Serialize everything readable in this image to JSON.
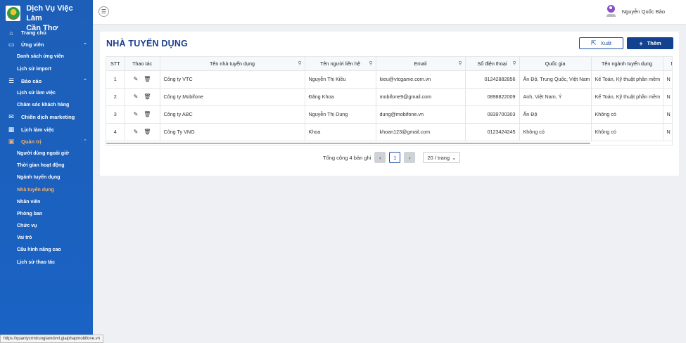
{
  "brand": {
    "title_line1": "Dịch Vụ Việc Làm",
    "title_line2": "Cần Thơ"
  },
  "sidebar": {
    "trang_chu": "Trang chủ",
    "ung_vien": "Ứng viên",
    "ung_vien_items": [
      "Danh sách ứng viên",
      "Lịch sử import"
    ],
    "bao_cao": "Báo cáo",
    "bao_cao_items": [
      "Lịch sử làm việc",
      "Chăm sóc khách hàng"
    ],
    "chien_dich": "Chiến dịch marketing",
    "lich_lam_viec": "Lịch làm việc",
    "quan_tri": "Quản trị",
    "quan_tri_items": [
      "Người dùng ngoài giờ",
      "Thời gian hoạt động",
      "Ngành tuyển dụng",
      "Nhà tuyển dụng",
      "Nhân viên",
      "Phòng ban",
      "Chức vụ",
      "Vai trò",
      "Cấu hình nâng cao",
      "Lịch sử thao tác"
    ]
  },
  "header": {
    "user_name": "Nguyễn Quốc Bảo"
  },
  "page": {
    "title": "NHÀ TUYỂN DỤNG",
    "export_label": "Xuất",
    "add_label": "Thêm"
  },
  "table": {
    "headers": [
      "STT",
      "Thao tác",
      "Tên nhà tuyển dụng",
      "Tên người liên hệ",
      "Email",
      "Số điện thoại",
      "Quốc gia",
      "Tên ngành tuyển dụng",
      "M"
    ],
    "rows": [
      {
        "stt": "1",
        "name": "Công ty VTC",
        "contact": "Nguyễn Thị Kiều",
        "email": "kieu@vtcgame.com.vn",
        "phone": "01242882856",
        "country": "Ấn Độ, Trung Quốc, Việt Nam",
        "industry": "Kế Toán, Kỹ thuật phần mềm",
        "extra": "N"
      },
      {
        "stt": "2",
        "name": "Công ty Mobifone",
        "contact": "Đăng Khoa",
        "email": "mobifone9@gmail.com",
        "phone": "0898822009",
        "country": "Anh, Việt Nam, Ý",
        "industry": "Kế Toán, Kỹ thuật phần mềm",
        "extra": "N"
      },
      {
        "stt": "3",
        "name": "Công ty ABC",
        "contact": "Nguyễn Thị Dung",
        "email": "dung@mobifone.vn",
        "phone": "0939700303",
        "country": "Ấn Độ",
        "industry": "Không có",
        "extra": "N"
      },
      {
        "stt": "4",
        "name": "Công Ty VNG",
        "contact": "Khoa",
        "email": "khoan123@gmail.com",
        "phone": "0123424245",
        "country": "Không có",
        "industry": "Không có",
        "extra": "N"
      }
    ]
  },
  "pagination": {
    "total": "Tổng cộng 4 bản ghi",
    "current_page": "1",
    "page_size": "20 / trang"
  },
  "status_bar": {
    "url": "https://quanlycrmtrungtamdvvl.giaiphapmobifone.vn"
  }
}
